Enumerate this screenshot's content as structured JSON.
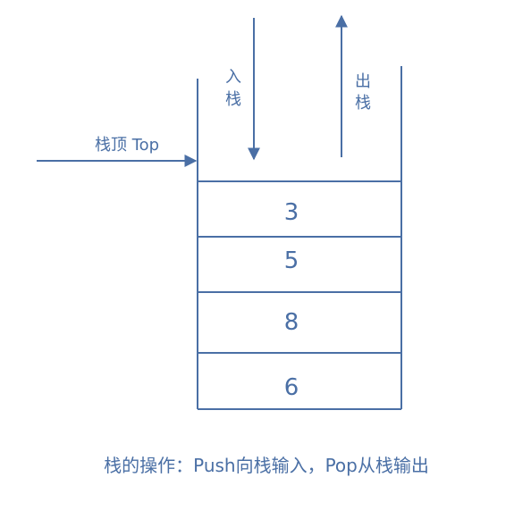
{
  "diagram": {
    "push_label_line1": "入",
    "push_label_line2": "栈",
    "pop_label_line1": "出",
    "pop_label_line2": "栈",
    "top_pointer_label": "栈顶 Top",
    "stack_values": [
      "3",
      "5",
      "8",
      "6"
    ],
    "caption": "栈的操作：Push向栈输入，Pop从栈输出"
  },
  "colors": {
    "accent": "#4a6fa5"
  }
}
